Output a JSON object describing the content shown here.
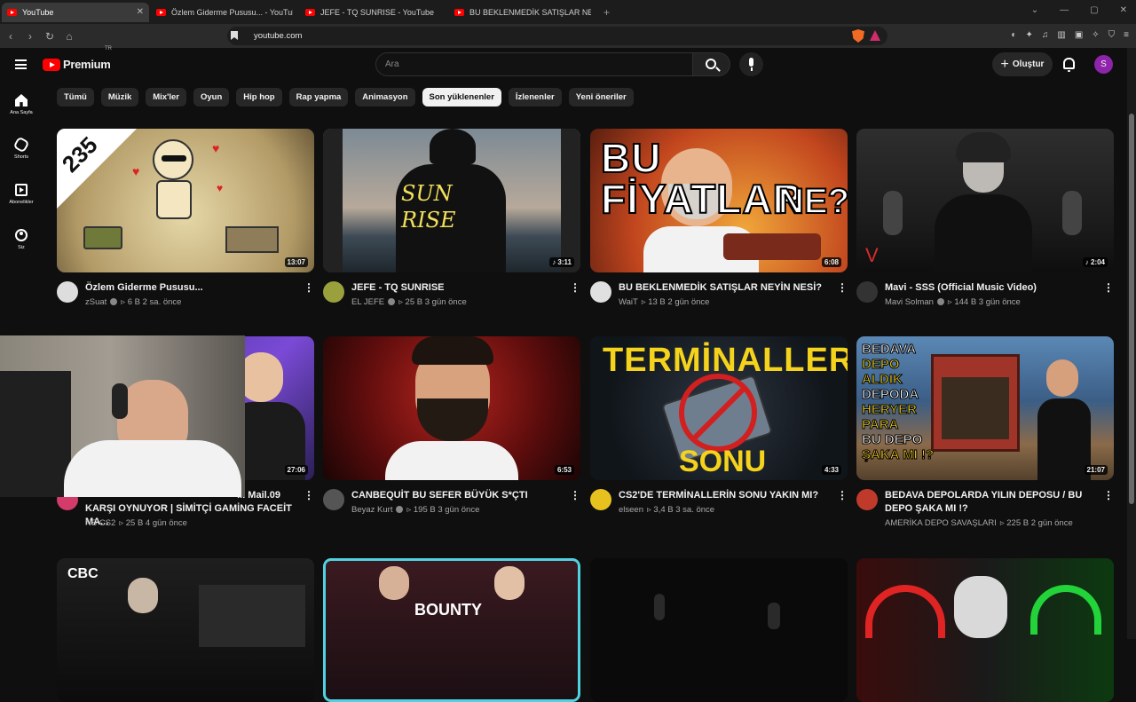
{
  "browser": {
    "tabs": [
      {
        "title": "YouTube",
        "close": "✕"
      },
      {
        "title": "Özlem Giderme Pususu... - YouTube"
      },
      {
        "title": "JEFE - TQ SUNRISE - YouTube"
      },
      {
        "title": "BU BEKLENMEDİK SATIŞLAR NEYİN N"
      }
    ],
    "new_tab": "+",
    "window_controls": [
      "⌄",
      "—",
      "▢",
      "✕"
    ],
    "url": "youtube.com"
  },
  "header": {
    "logo_text": "Premium",
    "region": "TR",
    "search_placeholder": "Ara",
    "create_label": "Oluştur",
    "create_plus": "+",
    "avatar_letter": "S"
  },
  "sidebar": {
    "items": [
      {
        "label": "Ana Sayfa",
        "icon": "home-icon"
      },
      {
        "label": "Shorts",
        "icon": "shorts-icon"
      },
      {
        "label": "Abonelikler",
        "icon": "subscriptions-icon"
      },
      {
        "label": "Siz",
        "icon": "you-icon"
      }
    ]
  },
  "chips": [
    "Tümü",
    "Müzik",
    "Mix'ler",
    "Oyun",
    "Hip hop",
    "Rap yapma",
    "Animasyon",
    "Son yüklenenler",
    "İzlenenler",
    "Yeni öneriler"
  ],
  "active_chip": "Son yüklenenler",
  "videos": [
    {
      "title": "Özlem Giderme Pususu...",
      "channel": "zSuat",
      "views": "▹ 6 B",
      "age": "2 sa. önce",
      "duration": "13:07",
      "thumb_text": "235"
    },
    {
      "title": "JEFE - TQ SUNRISE",
      "channel": "EL JEFE",
      "views": "▹ 25 B",
      "age": "3 gün önce",
      "duration": "♪ 3:11",
      "thumb_text": "SUN RISE"
    },
    {
      "title": "BU BEKLENMEDİK SATIŞLAR NEYİN NESİ?",
      "channel": "WaiT",
      "views": "▹ 13 B",
      "age": "2 gün önce",
      "duration": "6:08",
      "thumb_text": "BU FİYATLAR",
      "thumb_text2": "NE?"
    },
    {
      "title": "Mavi - SSS (Official Music Video)",
      "channel": "Mavi Solman",
      "views": "▹ 144 B",
      "age": "3 gün önce",
      "duration": "♪ 2:04"
    },
    {
      "title": "... Mail.09",
      "title2": "KARŞI OYNUYOR | SİMİTÇİ GAMİNG FACEİT MA...",
      "channel": "NS CS2",
      "views": "▹ 25 B",
      "age": "4 gün önce",
      "duration": "27:06"
    },
    {
      "title": "CANBEQUİT BU SEFER BÜYÜK S*ÇTI",
      "channel": "Beyaz Kurt",
      "views": "▹ 195 B",
      "age": "3 gün önce",
      "duration": "6:53"
    },
    {
      "title": "CS2'DE TERMİNALLERİN SONU YAKIN MI?",
      "channel": "elseen",
      "views": "▹ 3,4 B",
      "age": "3 sa. önce",
      "duration": "4:33",
      "thumb_text": "TERMİNALLERİN",
      "thumb_text2": "SONU"
    },
    {
      "title": "BEDAVA DEPOLARDA YILIN DEPOSU / BU DEPO ŞAKA MI !?",
      "channel": "AMERİKA DEPO SAVAŞLARI",
      "views": "▹ 225 B",
      "age": "2 gün önce",
      "duration": "21:07",
      "thumb_lines": [
        "BEDAVA",
        "DEPO ALDIK",
        "DEPODA",
        "HERYER PARA",
        "BU DEPO",
        "ŞAKA MI !?"
      ]
    },
    {
      "title": "",
      "thumb_text": "CBC"
    },
    {
      "title": "",
      "thumb_text": "BOUNTY"
    },
    {
      "title": ""
    },
    {
      "title": ""
    }
  ]
}
